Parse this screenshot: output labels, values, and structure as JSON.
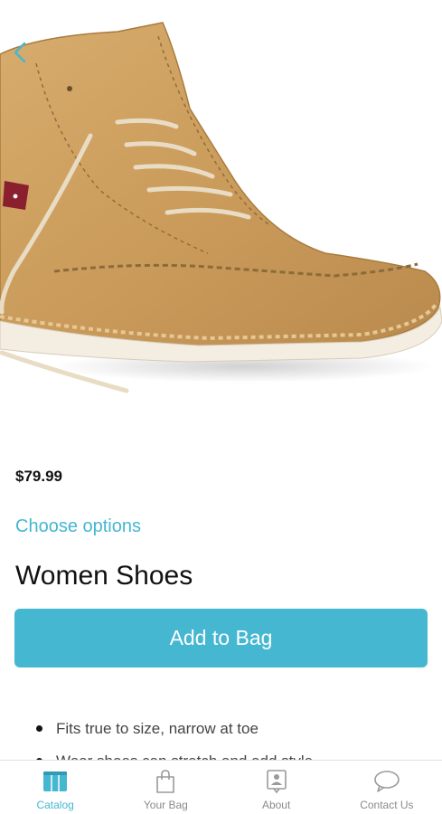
{
  "product": {
    "price": "$79.99",
    "choose_options": "Choose options",
    "title": "Women Shoes",
    "add_to_bag": "Add to Bag",
    "image": "product-photo-boot"
  },
  "description": {
    "bullets": [
      "Fits true to size, narrow at toe",
      "Wear shoes can stretch and add style"
    ]
  },
  "tabbar": {
    "tabs": [
      {
        "label": "Catalog",
        "icon": "catalog-icon",
        "active": true
      },
      {
        "label": "Your Bag",
        "icon": "bag-icon",
        "active": false
      },
      {
        "label": "About",
        "icon": "about-icon",
        "active": false
      },
      {
        "label": "Contact Us",
        "icon": "chat-icon",
        "active": false
      }
    ]
  },
  "colors": {
    "accent": "#45b7d1",
    "text": "#111111",
    "muted": "#8a8a8a"
  }
}
